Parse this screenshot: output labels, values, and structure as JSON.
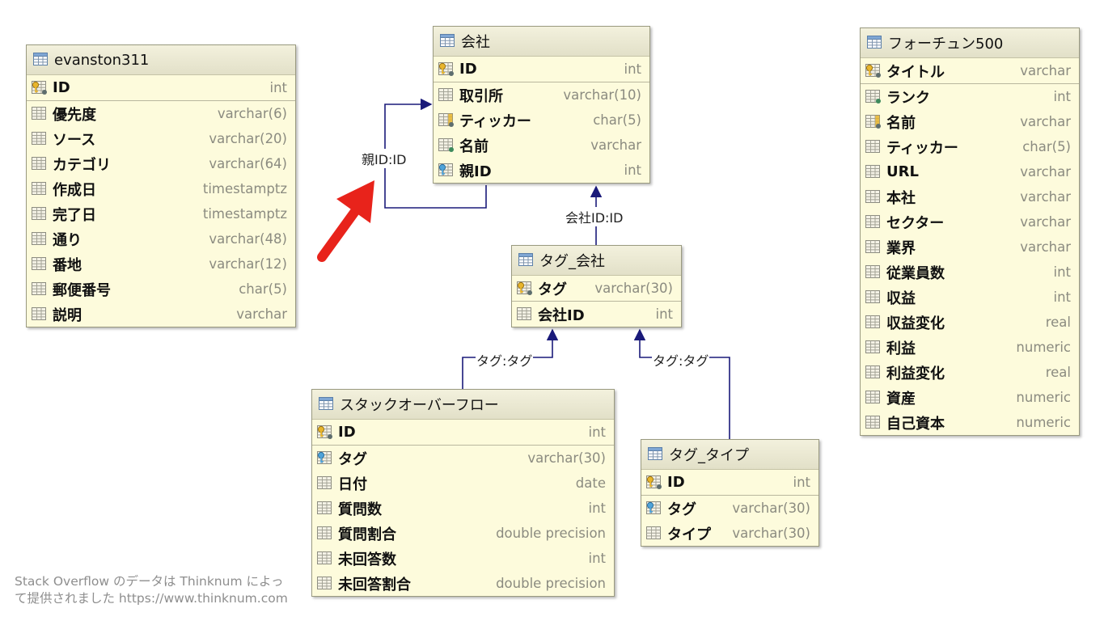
{
  "tables": {
    "evanston": {
      "title": "evanston311",
      "columns": [
        {
          "name": "ID",
          "type": "int",
          "icon": "primary-key-icon"
        },
        {
          "name": "優先度",
          "type": "varchar(6)",
          "icon": "column-icon"
        },
        {
          "name": "ソース",
          "type": "varchar(20)",
          "icon": "column-icon"
        },
        {
          "name": "カテゴリ",
          "type": "varchar(64)",
          "icon": "column-icon"
        },
        {
          "name": "作成日",
          "type": "timestamptz",
          "icon": "column-icon"
        },
        {
          "name": "完了日",
          "type": "timestamptz",
          "icon": "column-icon"
        },
        {
          "name": "通り",
          "type": "varchar(48)",
          "icon": "column-icon"
        },
        {
          "name": "番地",
          "type": "varchar(12)",
          "icon": "column-icon"
        },
        {
          "name": "郵便番号",
          "type": "char(5)",
          "icon": "column-icon"
        },
        {
          "name": "説明",
          "type": "varchar",
          "icon": "column-icon"
        }
      ]
    },
    "company": {
      "title": "会社",
      "columns": [
        {
          "name": "ID",
          "type": "int",
          "icon": "primary-key-icon"
        },
        {
          "name": "取引所",
          "type": "varchar(10)",
          "icon": "column-icon"
        },
        {
          "name": "ティッカー",
          "type": "char(5)",
          "icon": "unique-index-icon"
        },
        {
          "name": "名前",
          "type": "varchar",
          "icon": "not-null-column-icon"
        },
        {
          "name": "親ID",
          "type": "int",
          "icon": "foreign-key-icon"
        }
      ]
    },
    "tag_company": {
      "title": "タグ_会社",
      "columns": [
        {
          "name": "タグ",
          "type": "varchar(30)",
          "icon": "primary-key-icon"
        },
        {
          "name": "会社ID",
          "type": "int",
          "icon": "column-icon"
        }
      ]
    },
    "stackoverflow": {
      "title": "スタックオーバーフロー",
      "columns": [
        {
          "name": "ID",
          "type": "int",
          "icon": "primary-key-icon"
        },
        {
          "name": "タグ",
          "type": "varchar(30)",
          "icon": "foreign-key-icon"
        },
        {
          "name": "日付",
          "type": "date",
          "icon": "column-icon"
        },
        {
          "name": "質問数",
          "type": "int",
          "icon": "column-icon"
        },
        {
          "name": "質問割合",
          "type": "double precision",
          "icon": "column-icon"
        },
        {
          "name": "未回答数",
          "type": "int",
          "icon": "column-icon"
        },
        {
          "name": "未回答割合",
          "type": "double precision",
          "icon": "column-icon"
        }
      ]
    },
    "tag_type": {
      "title": "タグ_タイプ",
      "columns": [
        {
          "name": "ID",
          "type": "int",
          "icon": "primary-key-icon"
        },
        {
          "name": "タグ",
          "type": "varchar(30)",
          "icon": "foreign-key-icon"
        },
        {
          "name": "タイプ",
          "type": "varchar(30)",
          "icon": "column-icon"
        }
      ]
    },
    "fortune": {
      "title": "フォーチュン500",
      "columns": [
        {
          "name": "タイトル",
          "type": "varchar",
          "icon": "primary-key-icon"
        },
        {
          "name": "ランク",
          "type": "int",
          "icon": "not-null-column-icon"
        },
        {
          "name": "名前",
          "type": "varchar",
          "icon": "unique-index-icon"
        },
        {
          "name": "ティッカー",
          "type": "char(5)",
          "icon": "column-icon"
        },
        {
          "name": "URL",
          "type": "varchar",
          "icon": "column-icon"
        },
        {
          "name": "本社",
          "type": "varchar",
          "icon": "column-icon"
        },
        {
          "name": "セクター",
          "type": "varchar",
          "icon": "column-icon"
        },
        {
          "name": "業界",
          "type": "varchar",
          "icon": "column-icon"
        },
        {
          "name": "従業員数",
          "type": "int",
          "icon": "column-icon"
        },
        {
          "name": "収益",
          "type": "int",
          "icon": "column-icon"
        },
        {
          "name": "収益変化",
          "type": "real",
          "icon": "column-icon"
        },
        {
          "name": "利益",
          "type": "numeric",
          "icon": "column-icon"
        },
        {
          "name": "利益変化",
          "type": "real",
          "icon": "column-icon"
        },
        {
          "name": "資産",
          "type": "numeric",
          "icon": "column-icon"
        },
        {
          "name": "自己資本",
          "type": "numeric",
          "icon": "column-icon"
        }
      ]
    }
  },
  "relations": {
    "self_ref": "親ID:ID",
    "tag_company_to_company": "会社ID:ID",
    "stackoverflow_to_tag_company": "タグ:タグ",
    "tag_type_to_tag_company": "タグ:タグ"
  },
  "colors": {
    "arrow": "#e8231b",
    "line": "#1a1a7a",
    "table_bg": "#fdfbdc"
  },
  "credit": {
    "line1": "Stack Overflow のデータは Thinknum によっ",
    "line2": "て提供されました https://www.thinknum.com"
  }
}
